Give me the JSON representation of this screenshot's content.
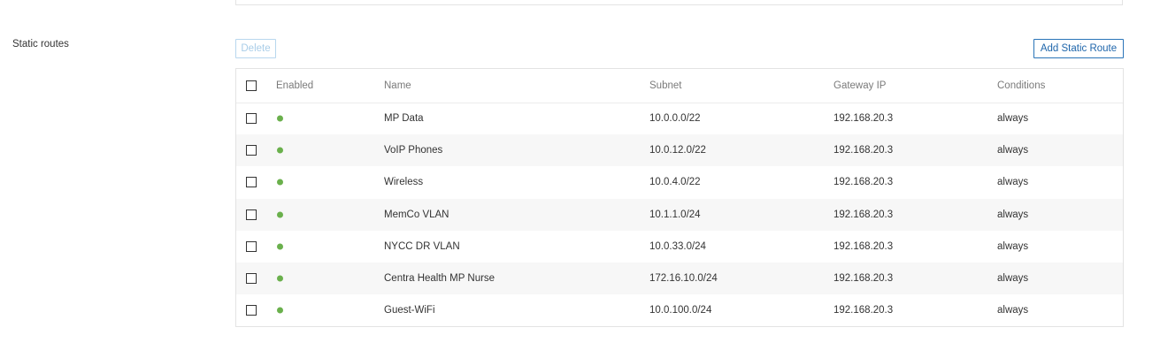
{
  "section": {
    "label": "Static routes"
  },
  "toolbar": {
    "delete_label": "Delete",
    "add_label": "Add Static Route"
  },
  "colors": {
    "enabled_dot": "#6ab04c",
    "primary": "#1f66ab"
  },
  "table": {
    "headers": {
      "enabled": "Enabled",
      "name": "Name",
      "subnet": "Subnet",
      "gateway": "Gateway IP",
      "conditions": "Conditions"
    },
    "rows": [
      {
        "enabled": true,
        "name": "MP Data",
        "subnet": "10.0.0.0/22",
        "gateway": "192.168.20.3",
        "conditions": "always"
      },
      {
        "enabled": true,
        "name": "VoIP Phones",
        "subnet": "10.0.12.0/22",
        "gateway": "192.168.20.3",
        "conditions": "always"
      },
      {
        "enabled": true,
        "name": "Wireless",
        "subnet": "10.0.4.0/22",
        "gateway": "192.168.20.3",
        "conditions": "always"
      },
      {
        "enabled": true,
        "name": "MemCo VLAN",
        "subnet": "10.1.1.0/24",
        "gateway": "192.168.20.3",
        "conditions": "always"
      },
      {
        "enabled": true,
        "name": "NYCC DR VLAN",
        "subnet": "10.0.33.0/24",
        "gateway": "192.168.20.3",
        "conditions": "always"
      },
      {
        "enabled": true,
        "name": "Centra Health MP Nurse",
        "subnet": "172.16.10.0/24",
        "gateway": "192.168.20.3",
        "conditions": "always"
      },
      {
        "enabled": true,
        "name": "Guest-WiFi",
        "subnet": "10.0.100.0/24",
        "gateway": "192.168.20.3",
        "conditions": "always"
      }
    ]
  }
}
